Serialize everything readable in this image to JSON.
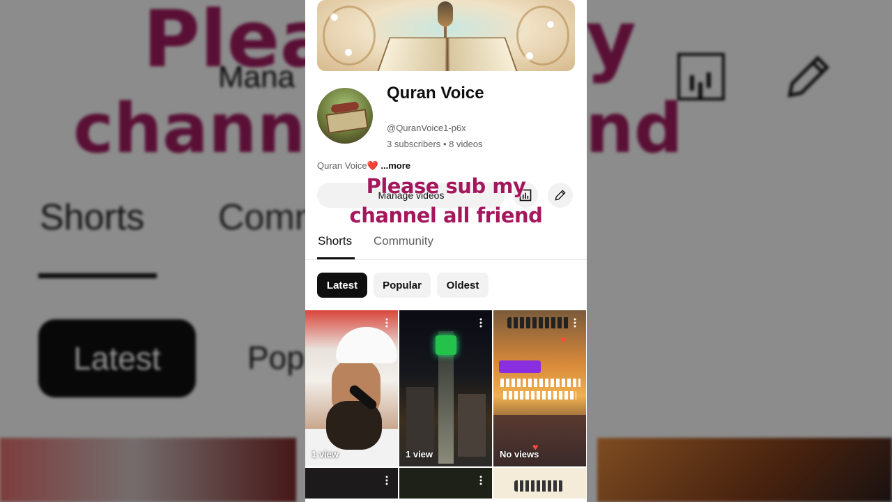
{
  "background": {
    "overlay_line1": "Pleas",
    "overlay_line2": "channe",
    "overlay_right1": "y",
    "overlay_right2": "nd",
    "manage_partial": "Mana",
    "shorts_tab": "Shorts",
    "community_partial": "Comn",
    "latest_chip": "Latest",
    "popular_partial": "Pop"
  },
  "channel": {
    "name": "Quran Voice",
    "handle": "@QuranVoice1-p6x",
    "subscribers": "3 subscribers",
    "separator": "•",
    "videos": "8 videos",
    "description": "Quran Voice❤️",
    "more_label": "...more"
  },
  "actions": {
    "manage_videos": "Manage videos"
  },
  "overlay": {
    "line1": "Please sub my",
    "line2": "channel all friend"
  },
  "tabs": [
    {
      "label": "Shorts",
      "active": true
    },
    {
      "label": "Community",
      "active": false
    }
  ],
  "filters": [
    {
      "label": "Latest",
      "selected": true
    },
    {
      "label": "Popular",
      "selected": false
    },
    {
      "label": "Oldest",
      "selected": false
    }
  ],
  "shorts": [
    {
      "views": "1 view"
    },
    {
      "views": "1 view"
    },
    {
      "views": "No views"
    },
    {
      "views": ""
    },
    {
      "views": ""
    },
    {
      "views": ""
    }
  ],
  "colors": {
    "overlay_text": "#a4175d",
    "chip_selected": "#0f0f0f",
    "chip_default": "#f2f2f2"
  }
}
